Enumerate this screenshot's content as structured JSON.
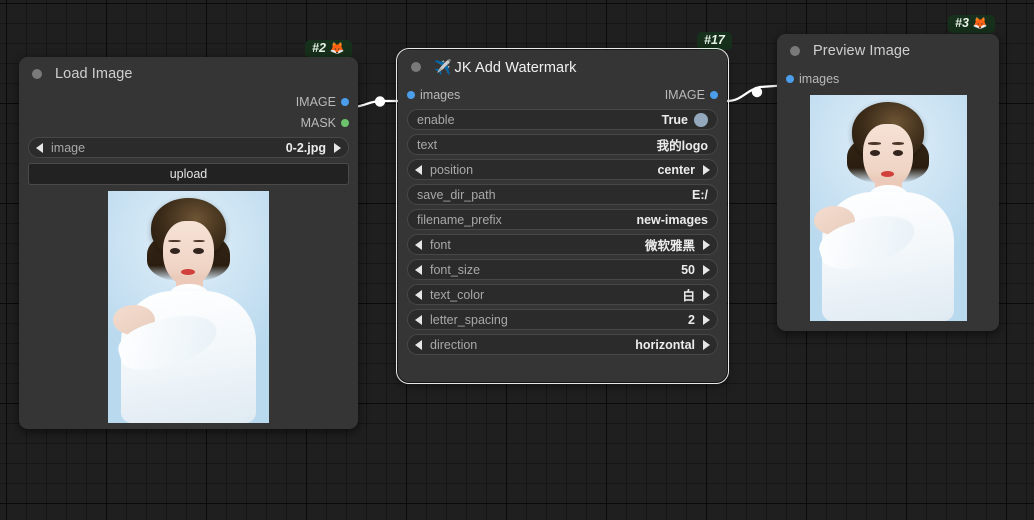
{
  "canvas": {
    "background_color": "#1f1f1f",
    "grid_color": "#000000"
  },
  "nodes": [
    {
      "id": "load-image",
      "badge": "#2",
      "badge_emoji": "🦊",
      "title": "Load Image",
      "title_emoji": "",
      "selected": false,
      "outputs": [
        {
          "label": "IMAGE",
          "color": "#4a9eeb"
        },
        {
          "label": "MASK",
          "color": "#6cc36c"
        }
      ],
      "inputs": [],
      "widgets": [
        {
          "type": "combo",
          "name": "image",
          "value": "0-2.jpg"
        },
        {
          "type": "button",
          "name": "upload",
          "value": "upload"
        }
      ],
      "has_image_preview": true
    },
    {
      "id": "jk-add-watermark",
      "badge": "#17",
      "badge_emoji": "",
      "title": "JK Add Watermark",
      "title_emoji": "✈️",
      "selected": true,
      "inputs": [
        {
          "label": "images",
          "color": "#4a9eeb"
        }
      ],
      "outputs": [
        {
          "label": "IMAGE",
          "color": "#4a9eeb"
        }
      ],
      "widgets": [
        {
          "type": "toggle",
          "name": "enable",
          "value": "True"
        },
        {
          "type": "text",
          "name": "text",
          "value": "我的logo"
        },
        {
          "type": "combo",
          "name": "position",
          "value": "center"
        },
        {
          "type": "text",
          "name": "save_dir_path",
          "value": "E:/"
        },
        {
          "type": "text",
          "name": "filename_prefix",
          "value": "new-images"
        },
        {
          "type": "combo",
          "name": "font",
          "value": "微软雅黑"
        },
        {
          "type": "combo",
          "name": "font_size",
          "value": "50"
        },
        {
          "type": "combo",
          "name": "text_color",
          "value": "白"
        },
        {
          "type": "combo",
          "name": "letter_spacing",
          "value": "2"
        },
        {
          "type": "combo",
          "name": "direction",
          "value": "horizontal"
        }
      ],
      "has_image_preview": false
    },
    {
      "id": "preview-image",
      "badge": "#3",
      "badge_emoji": "🦊",
      "title": "Preview Image",
      "title_emoji": "",
      "selected": false,
      "inputs": [
        {
          "label": "images",
          "color": "#4a9eeb"
        }
      ],
      "outputs": [],
      "widgets": [],
      "has_image_preview": true
    }
  ],
  "links": [
    {
      "from": "load-image.IMAGE",
      "to": "jk-add-watermark.images",
      "color": "#ffffff"
    },
    {
      "from": "jk-add-watermark.IMAGE",
      "to": "preview-image.images",
      "color": "#ffffff"
    }
  ]
}
